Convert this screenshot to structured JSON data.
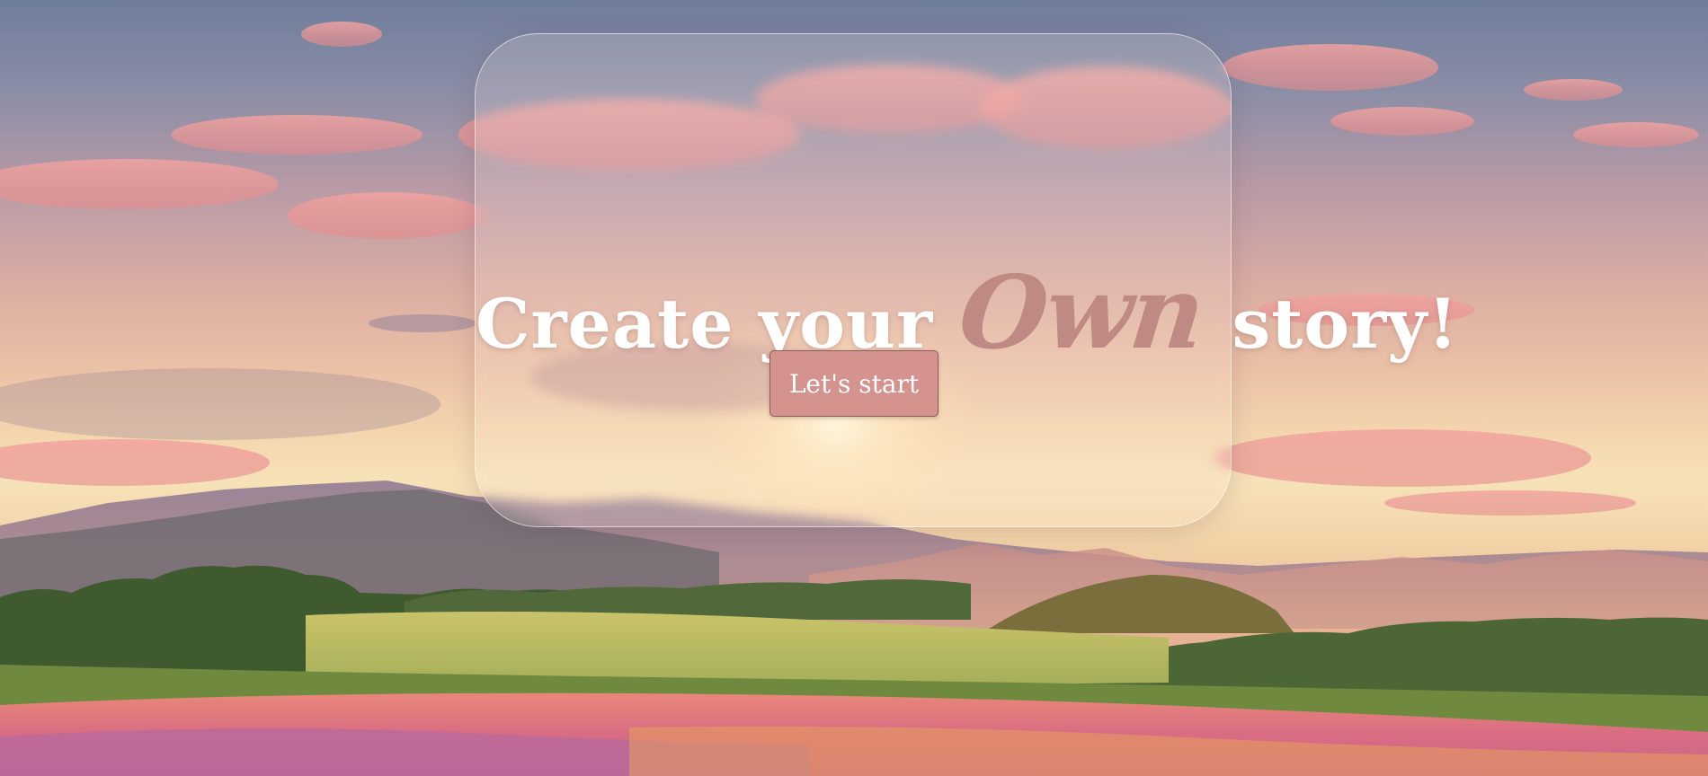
{
  "hero": {
    "headline_before": "Create your ",
    "headline_accent": "Own",
    "headline_after": " story!",
    "cta_label": "Let's start"
  },
  "colors": {
    "headline_text": "#ffffff",
    "accent_text": "#c08a84",
    "button_background": "#d4938f",
    "button_border": "#8d5c5c",
    "button_text": "#ffffff"
  },
  "background": {
    "icon": "sunset-landscape-image"
  }
}
